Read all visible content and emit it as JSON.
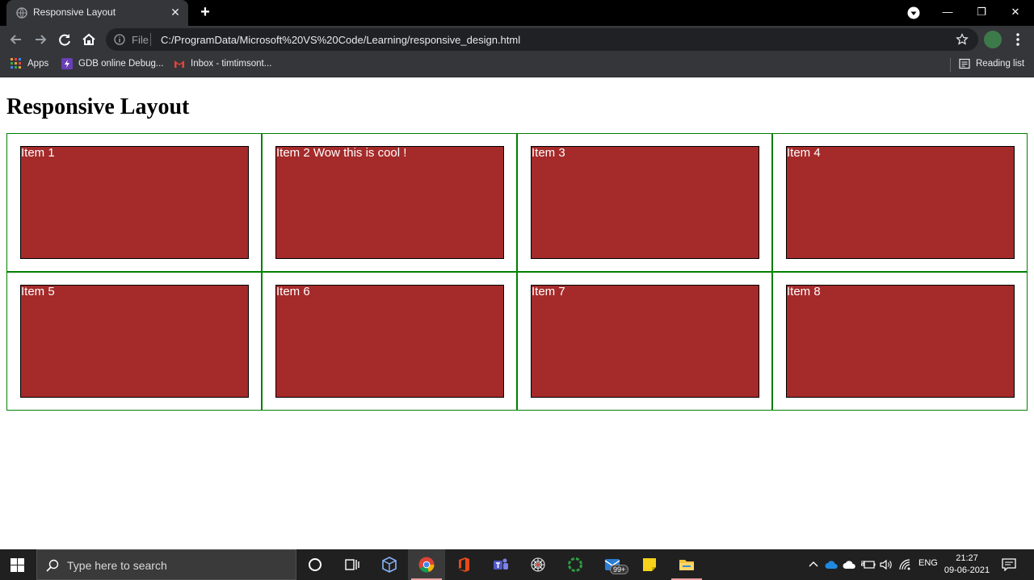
{
  "browser": {
    "tab_title": "Responsive Layout",
    "tab_close": "✕",
    "new_tab": "+",
    "win_minimize": "—",
    "win_restore": "❐",
    "win_close": "✕",
    "omnibox": {
      "scheme_label": "File",
      "url": "C:/ProgramData/Microsoft%20VS%20Code/Learning/responsive_design.html"
    },
    "bookmarks": [
      {
        "label": "Apps",
        "icon": "apps-grid-icon"
      },
      {
        "label": "GDB online Debug...",
        "icon": "gdb-icon"
      },
      {
        "label": "Inbox - timtimsont...",
        "icon": "gmail-icon"
      }
    ],
    "reading_list": "Reading list"
  },
  "page": {
    "title": "Responsive Layout",
    "items": [
      "Item 1",
      "Item 2 Wow this is cool !",
      "Item 3",
      "Item 4",
      "Item 5",
      "Item 6",
      "Item 7",
      "Item 8"
    ]
  },
  "taskbar": {
    "search_placeholder": "Type here to search",
    "mail_badge": "99+",
    "language": "ENG",
    "time": "21:27",
    "date": "09-06-2021"
  },
  "colors": {
    "item_background": "#a52a2a",
    "cell_border": "#008000",
    "titlebar": "#000000",
    "toolbar": "#35363a"
  }
}
